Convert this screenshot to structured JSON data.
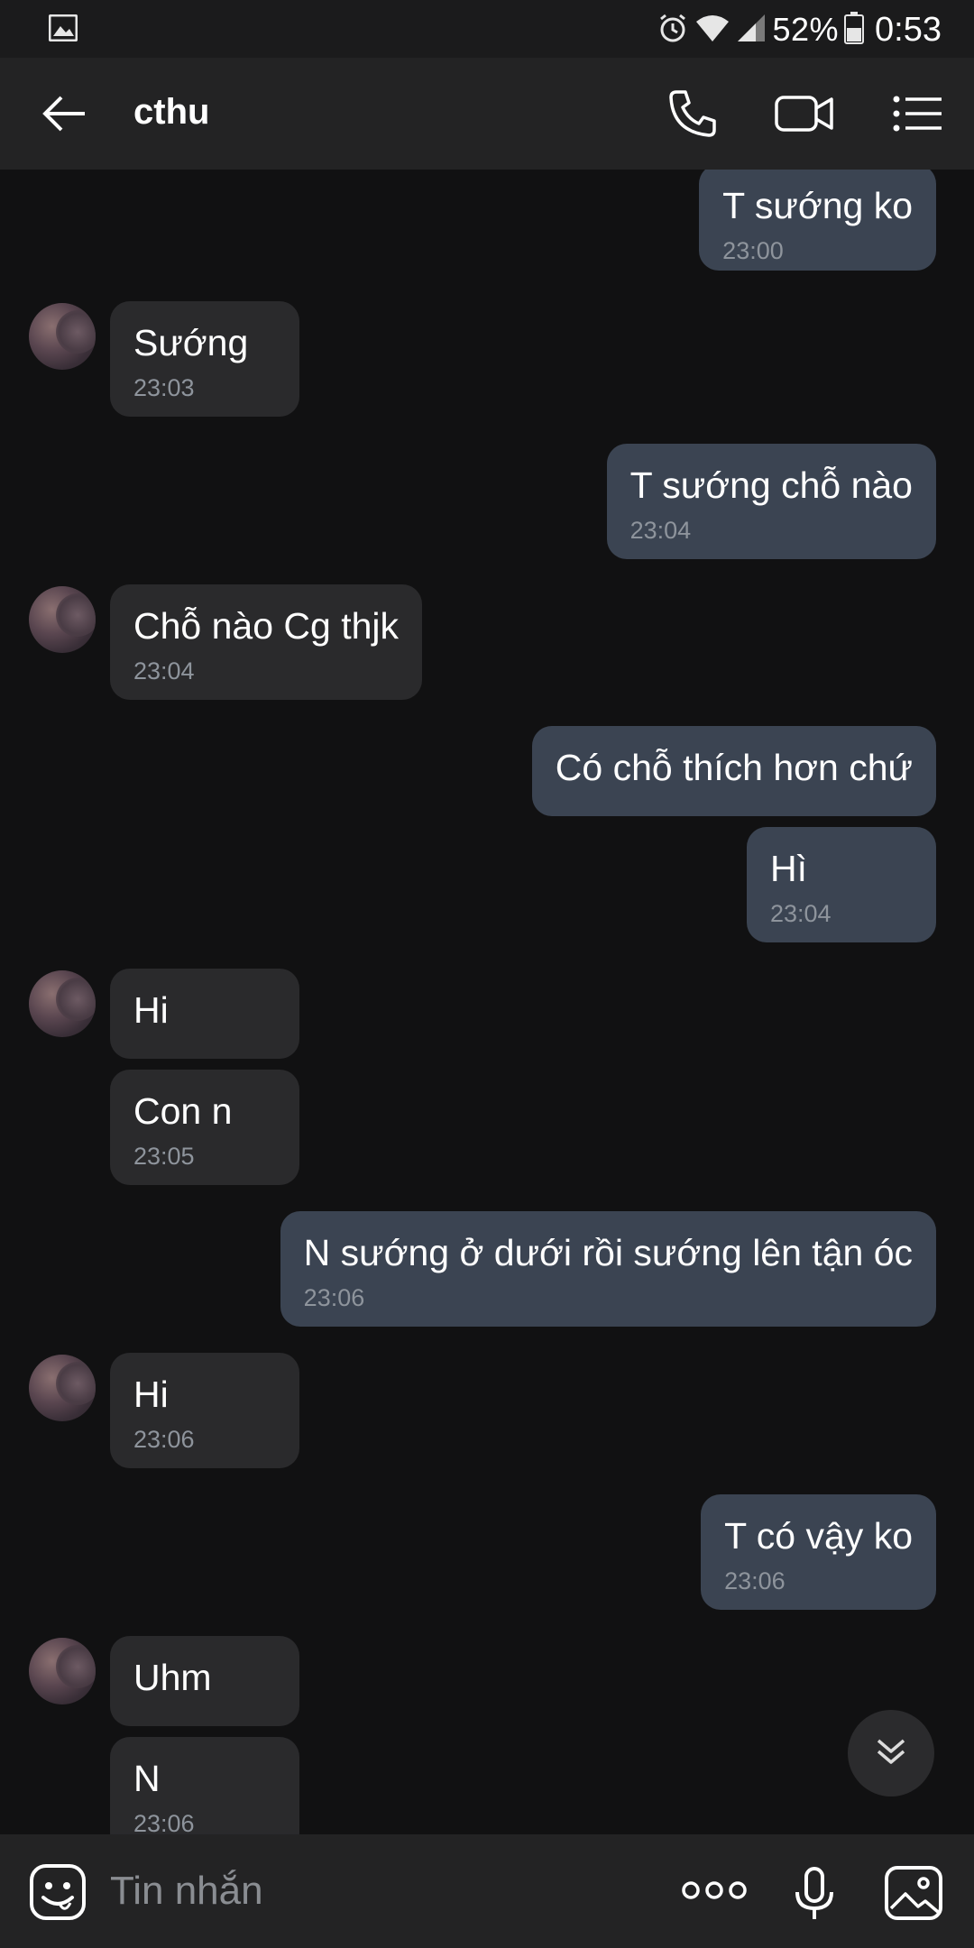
{
  "status_bar": {
    "battery_percent": "52%",
    "time": "0:53",
    "icons": [
      "image-icon",
      "alarm-icon",
      "wifi-icon",
      "signal-icon",
      "battery-icon"
    ]
  },
  "header": {
    "contact_name": "cthu",
    "icons": [
      "back-arrow-icon",
      "phone-icon",
      "video-call-icon",
      "menu-list-icon"
    ]
  },
  "messages": [
    {
      "dir": "out",
      "text": "T sướng ko",
      "time": "23:00"
    },
    {
      "dir": "in",
      "text": "Sướng",
      "time": "23:03"
    },
    {
      "dir": "out",
      "text": "T sướng chỗ nào",
      "time": "23:04"
    },
    {
      "dir": "in",
      "text": "Chỗ nào Cg thjk",
      "time": "23:04"
    },
    {
      "dir": "out",
      "text": "Có chỗ thích hơn chứ",
      "time": ""
    },
    {
      "dir": "out",
      "text": "Hì",
      "time": "23:04"
    },
    {
      "dir": "in",
      "text": "Hi",
      "time": ""
    },
    {
      "dir": "in",
      "text": "Con n",
      "time": "23:05"
    },
    {
      "dir": "out",
      "text": "N sướng ở dưới rồi sướng lên tận óc",
      "time": "23:06"
    },
    {
      "dir": "in",
      "text": "Hi",
      "time": "23:06"
    },
    {
      "dir": "out",
      "text": "T có vậy ko",
      "time": "23:06"
    },
    {
      "dir": "in",
      "text": "Uhm",
      "time": ""
    },
    {
      "dir": "in",
      "text": "N",
      "time": "23:06"
    }
  ],
  "input_bar": {
    "placeholder": "Tin nhắn",
    "icons": [
      "emoji-icon",
      "more-dots-icon",
      "microphone-icon",
      "gallery-icon"
    ]
  },
  "colors": {
    "background": "#111112",
    "header": "#232324",
    "incoming_bubble": "#2a2a2c",
    "outgoing_bubble": "#3b4452",
    "timestamp": "#8e949c"
  }
}
